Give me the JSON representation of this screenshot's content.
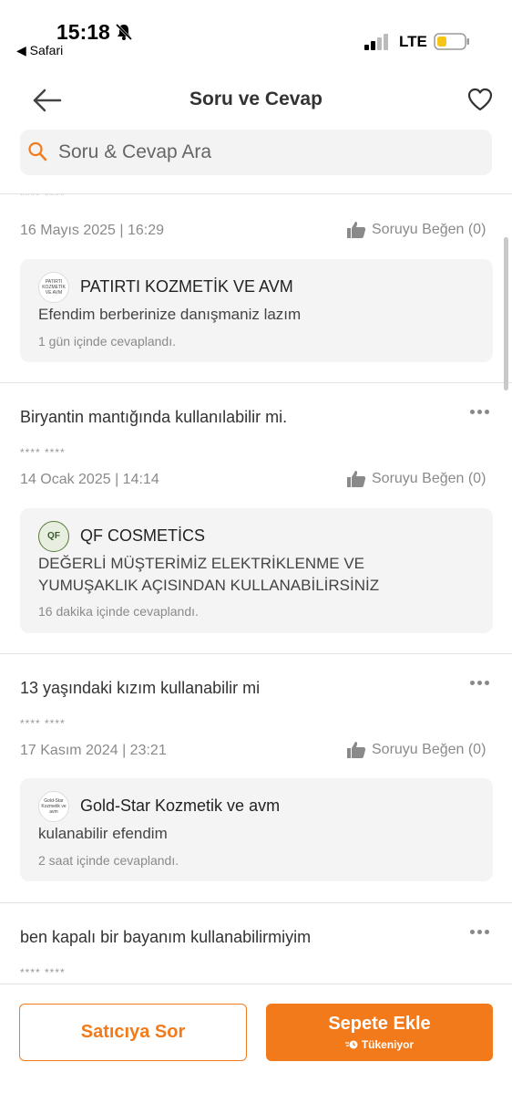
{
  "status": {
    "time": "15:18",
    "back_app": "◀ Safari",
    "network": "LTE"
  },
  "header": {
    "title": "Soru ve Cevap"
  },
  "search": {
    "placeholder": "Soru & Cevap Ara"
  },
  "qa_items": [
    {
      "question": "",
      "user": "**** ****",
      "date": "16 Mayıs 2025 | 16:29",
      "like_label": "Soruyu Beğen (0)",
      "seller_logo_text": "PATIRTI KOZMETİK VE AVM",
      "seller": "PATIRTI KOZMETİK VE AVM",
      "answer": "Efendim berberinize danışmaniz lazım",
      "answer_time": "1 gün içinde cevaplandı."
    },
    {
      "question": "Biryantin mantığında kullanılabilir mi.",
      "user": "**** ****",
      "date": "14 Ocak 2025 | 14:14",
      "like_label": "Soruyu Beğen (0)",
      "seller_logo_text": "QF",
      "seller": "QF COSMETİCS",
      "answer": "DEĞERLİ MÜŞTERİMİZ ELEKTRİKLENME VE YUMUŞAKLIK  AÇISINDAN KULLANABİLİRSİNİZ",
      "answer_time": "16 dakika içinde cevaplandı."
    },
    {
      "question": "13 yaşındaki kızım kullanabilir mi",
      "user": "**** ****",
      "date": "17 Kasım 2024 | 23:21",
      "like_label": "Soruyu Beğen (0)",
      "seller_logo_text": "Gold-Star Kozmetik ve avm",
      "seller": "Gold-Star  Kozmetik ve avm",
      "answer": "kulanabilir efendim",
      "answer_time": "2 saat içinde cevaplandı."
    },
    {
      "question": "ben kapalı bir bayanım kullanabilirmiyim",
      "user": "**** ****"
    }
  ],
  "bottom": {
    "ask_label": "Satıcıya Sor",
    "cart_label": "Sepete Ekle",
    "cart_sub": "Tükeniyor"
  },
  "colors": {
    "accent": "#f27a1a"
  }
}
